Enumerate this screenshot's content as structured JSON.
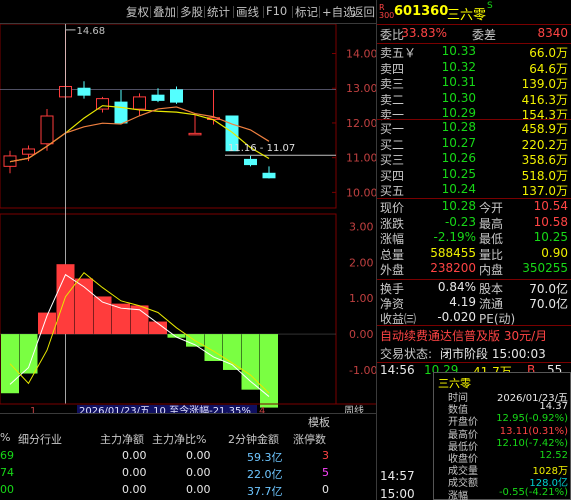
{
  "toolbar": {
    "items": [
      "复权",
      "叠加",
      "多股",
      "统计",
      "画线",
      "F10",
      "标记",
      "+自选",
      "返回"
    ]
  },
  "chart": {
    "max_annotation": "14.68",
    "range_label": "11.16 - 11.07",
    "price_axis": [
      "14.00",
      "13.00",
      "12.00",
      "11.00",
      "10.00"
    ],
    "macd_axis": [
      "3.00",
      "2.00",
      "1.00",
      "0.00",
      "-1.00"
    ],
    "bottom_bar": {
      "left_mark": "1",
      "range_text": "2026/01/23/五 10 至今涨幅-21.35%",
      "right_mark": "4",
      "zhouxian": "周线"
    },
    "chart_data": {
      "type": "candlestick",
      "candles": [
        {
          "o": 10.75,
          "c": 11.05,
          "h": 11.2,
          "l": 10.55
        },
        {
          "o": 11.1,
          "c": 11.25,
          "h": 11.35,
          "l": 10.9
        },
        {
          "o": 11.4,
          "c": 12.2,
          "h": 12.4,
          "l": 11.2
        },
        {
          "o": 12.75,
          "c": 13.05,
          "h": 14.68,
          "l": 12.7
        },
        {
          "o": 13.0,
          "c": 12.8,
          "h": 13.2,
          "l": 12.7
        },
        {
          "o": 12.4,
          "c": 12.7,
          "h": 12.75,
          "l": 12.3
        },
        {
          "o": 12.6,
          "c": 12.0,
          "h": 12.95,
          "l": 12.0
        },
        {
          "o": 12.4,
          "c": 12.75,
          "h": 12.85,
          "l": 12.2
        },
        {
          "o": 12.8,
          "c": 12.65,
          "h": 13.0,
          "l": 12.6
        },
        {
          "o": 12.95,
          "c": 12.6,
          "h": 13.05,
          "l": 12.55
        },
        {
          "o": 11.7,
          "c": 11.7,
          "h": 12.25,
          "l": 11.65
        },
        {
          "o": 12.1,
          "c": 12.15,
          "h": 12.95,
          "l": 11.95
        },
        {
          "o": 12.2,
          "c": 11.2,
          "h": 12.2,
          "l": 11.2
        },
        {
          "o": 10.95,
          "c": 10.8,
          "h": 11.05,
          "l": 10.75
        },
        {
          "o": 10.55,
          "c": 10.42,
          "h": 10.75,
          "l": 10.4
        }
      ],
      "macd": [
        -1.65,
        -1.1,
        0.6,
        1.95,
        1.55,
        1.05,
        0.85,
        0.8,
        0.35,
        -0.1,
        -0.35,
        -0.75,
        -1.0,
        -1.55,
        -2.05
      ],
      "ylim_price": [
        9.55,
        14.85
      ],
      "ylim_macd": [
        -1.95,
        3.35
      ]
    }
  },
  "quote": {
    "code_prefix": "R\n300",
    "code": "601360",
    "name": "三六零",
    "badge": "S",
    "weibi_label": "委比",
    "weibi": "33.83%",
    "weicha_label": "委差",
    "weicha": "8340",
    "asks": [
      {
        "label": "卖五￥",
        "price": "10.33",
        "vol": "66.0万"
      },
      {
        "label": "卖四",
        "price": "10.32",
        "vol": "64.6万"
      },
      {
        "label": "卖三",
        "price": "10.31",
        "vol": "139.0万"
      },
      {
        "label": "卖二",
        "price": "10.30",
        "vol": "416.3万"
      },
      {
        "label": "卖一",
        "price": "10.29",
        "vol": "154.3万"
      }
    ],
    "bids": [
      {
        "label": "买一",
        "price": "10.28",
        "vol": "458.9万"
      },
      {
        "label": "买二",
        "price": "10.27",
        "vol": "220.2万"
      },
      {
        "label": "买三",
        "price": "10.26",
        "vol": "358.6万"
      },
      {
        "label": "买四",
        "price": "10.25",
        "vol": "518.0万"
      },
      {
        "label": "买五",
        "price": "10.24",
        "vol": "137.0万"
      }
    ],
    "stats": [
      {
        "l1": "现价",
        "v1": "10.28",
        "c1": "grn",
        "l2": "今开",
        "v2": "10.54",
        "c2": "red"
      },
      {
        "l1": "涨跌",
        "v1": "-0.23",
        "c1": "grn",
        "l2": "最高",
        "v2": "10.58",
        "c2": "red"
      },
      {
        "l1": "涨幅",
        "v1": "-2.19%",
        "c1": "grn",
        "l2": "最低",
        "v2": "10.25",
        "c2": "grn"
      },
      {
        "l1": "总量",
        "v1": "588455",
        "c1": "yel",
        "l2": "量比",
        "v2": "0.90",
        "c2": "yel"
      },
      {
        "l1": "外盘",
        "v1": "238200",
        "c1": "red",
        "l2": "内盘",
        "v2": "350255",
        "c2": "grn"
      }
    ],
    "fin": [
      {
        "l1": "换手",
        "v1": "0.84%",
        "l2": "股本",
        "v2": "70.0亿"
      },
      {
        "l1": "净资",
        "v1": "4.19",
        "l2": "流通",
        "v2": "70.0亿"
      },
      {
        "l1": "收益㈢",
        "v1": "-0.020",
        "l2": "PE(动)",
        "v2": ""
      }
    ],
    "promo": "自动续费通达信普及版  30元/月",
    "status_label": "交易状态:",
    "status": "闭市阶段 15:00:03",
    "ticks": [
      {
        "time": "14:56",
        "price": "10.29",
        "vol": "41.7万",
        "side": "B",
        "n": "55"
      },
      {
        "time": "14:57",
        "price": "",
        "vol": "",
        "side": "",
        "n": ""
      },
      {
        "time": "15:00",
        "price": "",
        "vol": "",
        "side": "",
        "n": ""
      }
    ]
  },
  "popup": {
    "title": "三六零",
    "rows": [
      {
        "k": "时间",
        "v": "2026/01/23/五",
        "c": "wht"
      },
      {
        "k": "数值",
        "v": "14.37",
        "c": "wht"
      },
      {
        "k": "开盘价",
        "v": "12.95(-0.92%)",
        "c": "grn"
      },
      {
        "k": "最高价",
        "v": "13.11(0.31%)",
        "c": "red"
      },
      {
        "k": "最低价",
        "v": "12.10(-7.42%)",
        "c": "grn"
      },
      {
        "k": "收盘价",
        "v": "12.52",
        "c": "grn"
      },
      {
        "k": "成交量",
        "v": "1028万",
        "c": "yel"
      },
      {
        "k": "成交额",
        "v": "128.0亿",
        "c": "cyan"
      },
      {
        "k": "涨幅",
        "v": "-0.55(-4.21%)",
        "c": "grn"
      }
    ]
  },
  "bottom": {
    "tabs": [
      "模板"
    ],
    "headers": [
      "%",
      "细分行业",
      "主力净额",
      "主力净比%",
      "2分钟金额",
      "涨停数"
    ],
    "rows": [
      {
        "a": "69",
        "b": "0.00",
        "c": "0.00",
        "d": "59.3亿",
        "e": "3",
        "ec": "red"
      },
      {
        "a": "74",
        "b": "0.00",
        "c": "0.00",
        "d": "22.0亿",
        "e": "5",
        "ec": "mag"
      },
      {
        "a": "00",
        "b": "0.00",
        "c": "0.00",
        "d": "37.7亿",
        "e": "0",
        "ec": "wht"
      }
    ]
  }
}
